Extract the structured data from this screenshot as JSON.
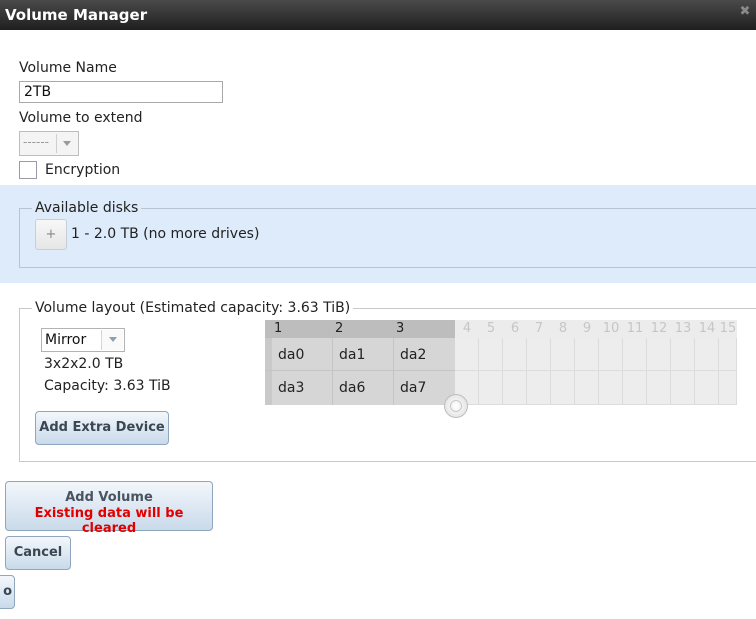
{
  "window": {
    "title": "Volume Manager"
  },
  "form": {
    "volume_name_label": "Volume Name",
    "volume_name_value": "2TB",
    "volume_extend_label": "Volume to extend",
    "volume_extend_value": "------",
    "encryption_label": "Encryption"
  },
  "available": {
    "legend": "Available disks",
    "add_label": "+",
    "disk_text": "1 - 2.0 TB (no more drives)"
  },
  "layout": {
    "legend": "Volume layout (Estimated capacity: 3.63 TiB)",
    "type_value": "Mirror",
    "config_text": "3x2x2.0 TB",
    "capacity_text": "Capacity: 3.63 TiB",
    "add_extra_label": "Add Extra Device",
    "columns": [
      "1",
      "2",
      "3",
      "4",
      "5",
      "6",
      "7",
      "8",
      "9",
      "10",
      "11",
      "12",
      "13",
      "14",
      "15"
    ],
    "row1": [
      "da0",
      "da1",
      "da2"
    ],
    "row2": [
      "da3",
      "da6",
      "da7"
    ]
  },
  "actions": {
    "add_volume_label": "Add Volume",
    "add_volume_warning": "Existing data will be cleared",
    "cancel_label": "Cancel",
    "partial_label": "o"
  }
}
